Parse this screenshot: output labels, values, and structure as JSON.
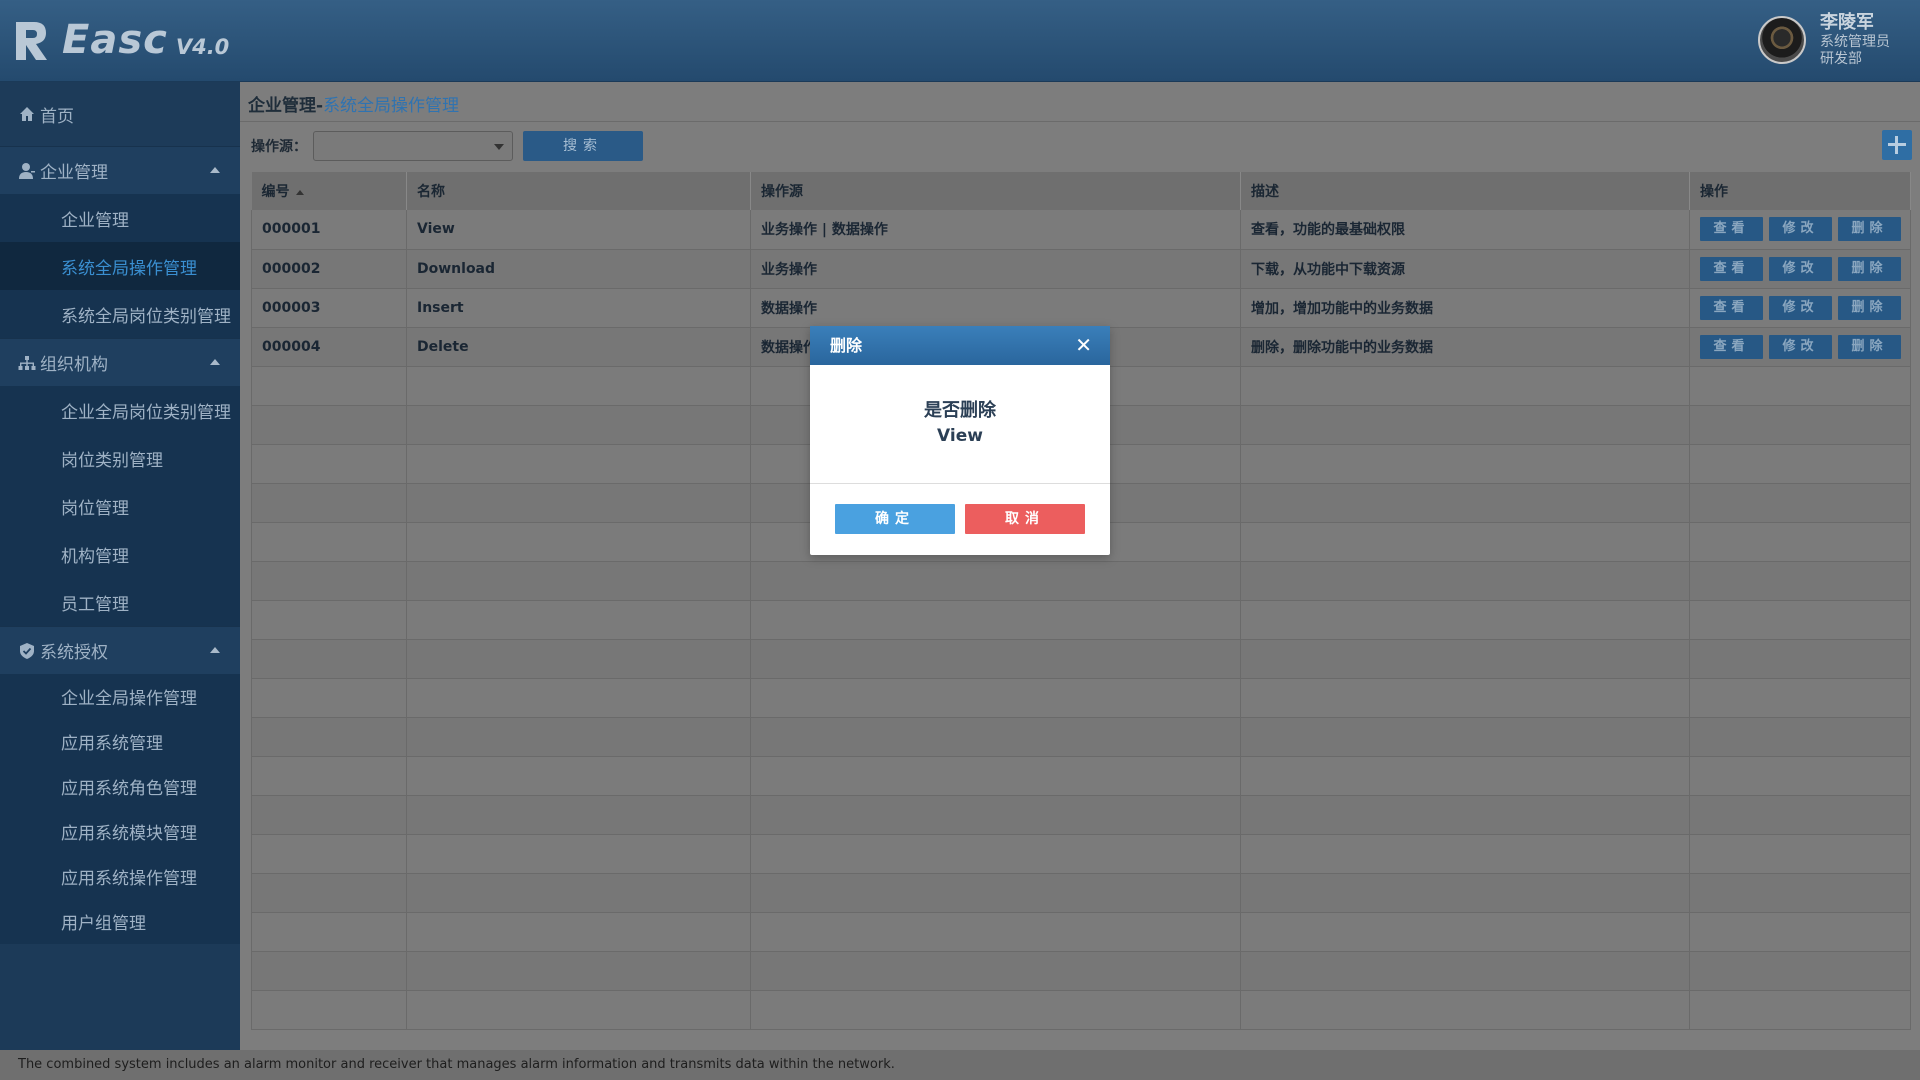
{
  "header": {
    "logo_text": "Easc",
    "logo_version": "V4.0",
    "user": {
      "name": "李陵军",
      "role": "系统管理员",
      "dept": "研发部"
    }
  },
  "sidebar": {
    "home": "首页",
    "groups": [
      {
        "label": "企业管理",
        "icon": "user-icon",
        "items": [
          "企业管理",
          "系统全局操作管理",
          "系统全局岗位类别管理"
        ]
      },
      {
        "label": "组织机构",
        "icon": "org-chart-icon",
        "items": [
          "企业全局岗位类别管理",
          "岗位类别管理",
          "岗位管理",
          "机构管理",
          "员工管理"
        ]
      },
      {
        "label": "系统授权",
        "icon": "shield-icon",
        "items": [
          "企业全局操作管理",
          "应用系统管理",
          "应用系统角色管理",
          "应用系统模块管理",
          "应用系统操作管理",
          "用户组管理"
        ]
      }
    ],
    "active_item": "系统全局操作管理"
  },
  "breadcrumb": {
    "parent": "企业管理-",
    "current": "系统全局操作管理"
  },
  "filter": {
    "label": "操作源：",
    "select_value": "",
    "search_label": "搜索"
  },
  "table": {
    "headers": [
      "编号",
      "名称",
      "操作源",
      "描述",
      "操作"
    ],
    "rows": [
      {
        "id": "000001",
        "name": "View",
        "source": "业务操作 | 数据操作",
        "desc": "查看，功能的最基础权限"
      },
      {
        "id": "000002",
        "name": "Download",
        "source": "业务操作",
        "desc": "下载，从功能中下载资源"
      },
      {
        "id": "000003",
        "name": "Insert",
        "source": "数据操作",
        "desc": "增加，增加功能中的业务数据"
      },
      {
        "id": "000004",
        "name": "Delete",
        "source": "数据操作",
        "desc": "删除，删除功能中的业务数据"
      }
    ],
    "row_actions": {
      "view": "查看",
      "edit": "修改",
      "delete": "删除"
    }
  },
  "modal": {
    "title": "删除",
    "question": "是否删除",
    "item": "View",
    "ok": "确定",
    "cancel": "取消"
  },
  "footer": {
    "text": "The combined system includes an alarm monitor and receiver that manages alarm information and transmits data within the network."
  },
  "colors": {
    "accent": "#2f73b1",
    "ok": "#4aa1e0",
    "cancel": "#ec5e5e"
  }
}
